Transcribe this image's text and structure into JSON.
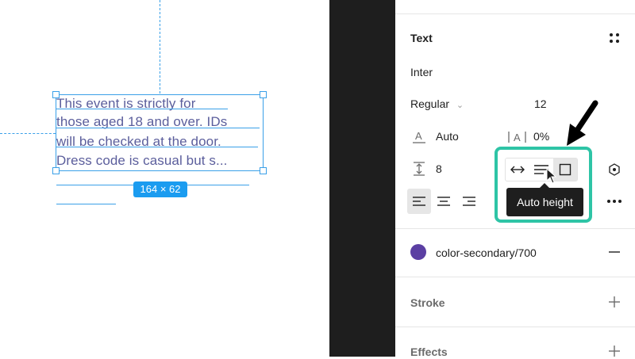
{
  "canvas": {
    "text_lines": [
      "This event is strictly for",
      "those aged 18 and over. IDs",
      "will be checked at the door.",
      "Dress code is casual but s..."
    ],
    "size_badge": "164 × 62"
  },
  "panel": {
    "text_section": {
      "title": "Text",
      "font_family": "Inter",
      "font_weight": "Regular",
      "font_size": "12",
      "line_height": "Auto",
      "letter_spacing": "0%",
      "paragraph_spacing": "8"
    },
    "resize_options": [
      "auto-width",
      "auto-height",
      "fixed-size"
    ],
    "tooltip": "Auto height",
    "fill": {
      "swatch_color": "#5b3fa3",
      "name": "color-secondary/700"
    },
    "stroke_title": "Stroke",
    "effects_title": "Effects"
  },
  "colors": {
    "highlight": "#2ec4a6",
    "selection": "#3aa0e8",
    "text": "#5b5e9c"
  }
}
